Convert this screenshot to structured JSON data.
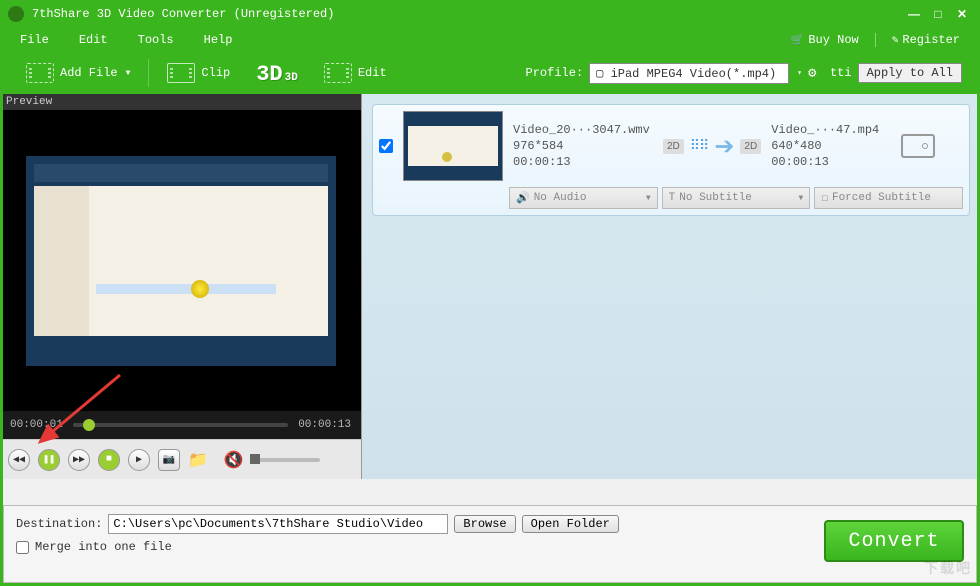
{
  "window": {
    "title": "7thShare 3D Video Converter (Unregistered)"
  },
  "menu": {
    "file": "File",
    "edit": "Edit",
    "tools": "Tools",
    "help": "Help",
    "buy_now": "Buy Now",
    "register": "Register"
  },
  "toolbar": {
    "add_file": "Add File",
    "clip": "Clip",
    "threed": "3D",
    "threed_sm": "3D",
    "edit": "Edit",
    "profile_label": "Profile:",
    "profile_value": "iPad MPEG4 Video(*.mp4)",
    "tti": "tti",
    "apply_all": "Apply to All"
  },
  "preview": {
    "label": "Preview",
    "time_current": "00:00:01",
    "time_total": "00:00:13"
  },
  "file": {
    "src_name": "Video_20···3047.wmv",
    "src_res": "976*584",
    "src_dur": "00:00:13",
    "badge_2d_a": "2D",
    "badge_2d_b": "2D",
    "dst_name": "Video_···47.mp4",
    "dst_res": "640*480",
    "dst_dur": "00:00:13",
    "no_audio": "No Audio",
    "no_subtitle": "No Subtitle",
    "forced_subtitle": "Forced Subtitle"
  },
  "bottom": {
    "dest_label": "Destination:",
    "dest_path": "C:\\Users\\pc\\Documents\\7thShare Studio\\Video",
    "browse": "Browse",
    "open_folder": "Open Folder",
    "merge": "Merge into one file",
    "convert": "Convert"
  }
}
